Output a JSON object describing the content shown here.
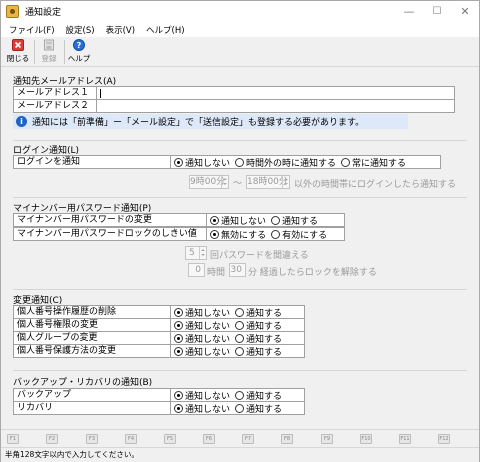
{
  "window": {
    "title": "通知設定",
    "minimize": "—",
    "maximize": "☐",
    "close": "✕"
  },
  "menu": [
    "ファイル(F)",
    "設定(S)",
    "表示(V)",
    "ヘルプ(H)"
  ],
  "toolbar": {
    "close_label": "閉じる",
    "register_label": "登録",
    "help_label": "ヘルプ"
  },
  "mail": {
    "title": "通知先メールアドレス(A)",
    "address1_label": "メールアドレス１",
    "address1_value": "",
    "address2_label": "メールアドレス２",
    "address2_value": "",
    "info": "通知には「前準備」ー「メール設定」で「送信設定」も登録する必要があります。",
    "info_icon": "i"
  },
  "login": {
    "title": "ログイン通知(L)",
    "row_label": "ログインを通知",
    "options": [
      "通知しない",
      "時間外の時に通知する",
      "常に通知する"
    ],
    "selected": 0,
    "start_time": "9時00分",
    "tilde": "～",
    "end_time": "18時00分",
    "suffix": "以外の時間帯にログインしたら通知する"
  },
  "mynumber": {
    "title": "マイナンバー用パスワード通知(P)",
    "rows": [
      {
        "label": "マイナンバー用パスワードの変更",
        "options": [
          "通知しない",
          "通知する"
        ],
        "selected": 0
      },
      {
        "label": "マイナンバー用パスワードロックのしきい値",
        "options": [
          "無効にする",
          "有効にする"
        ],
        "selected": 0
      }
    ],
    "threshold_count": "5",
    "threshold_text": "回パスワードを間違える",
    "lock_hours": "0",
    "hours_unit": "時間",
    "lock_minutes": "30",
    "lock_text": "分 経過したらロックを解除する"
  },
  "changes": {
    "title": "変更通知(C)",
    "rows": [
      {
        "label": "個人番号操作履歴の削除",
        "options": [
          "通知しない",
          "通知する"
        ],
        "selected": 0
      },
      {
        "label": "個人番号権限の変更",
        "options": [
          "通知しない",
          "通知する"
        ],
        "selected": 0
      },
      {
        "label": "個人グループの変更",
        "options": [
          "通知しない",
          "通知する"
        ],
        "selected": 0
      },
      {
        "label": "個人番号保護方法の変更",
        "options": [
          "通知しない",
          "通知する"
        ],
        "selected": 0
      }
    ]
  },
  "backup": {
    "title": "バックアップ・リカバリの通知(B)",
    "rows": [
      {
        "label": "バックアップ",
        "options": [
          "通知しない",
          "通知する"
        ],
        "selected": 0
      },
      {
        "label": "リカバリ",
        "options": [
          "通知しない",
          "通知する"
        ],
        "selected": 0
      }
    ]
  },
  "fkeys": [
    "F1",
    "F2",
    "F3",
    "F4",
    "F5",
    "F6",
    "F7",
    "F8",
    "F9",
    "F10",
    "F11",
    "F12"
  ],
  "status": "半角128文字以内で入力してください。",
  "colors": {
    "info_bg": "#dde9f8",
    "info_icon": "#1f63c6",
    "close_icon": "#e03a3a",
    "help_icon": "#2a6fd6"
  }
}
